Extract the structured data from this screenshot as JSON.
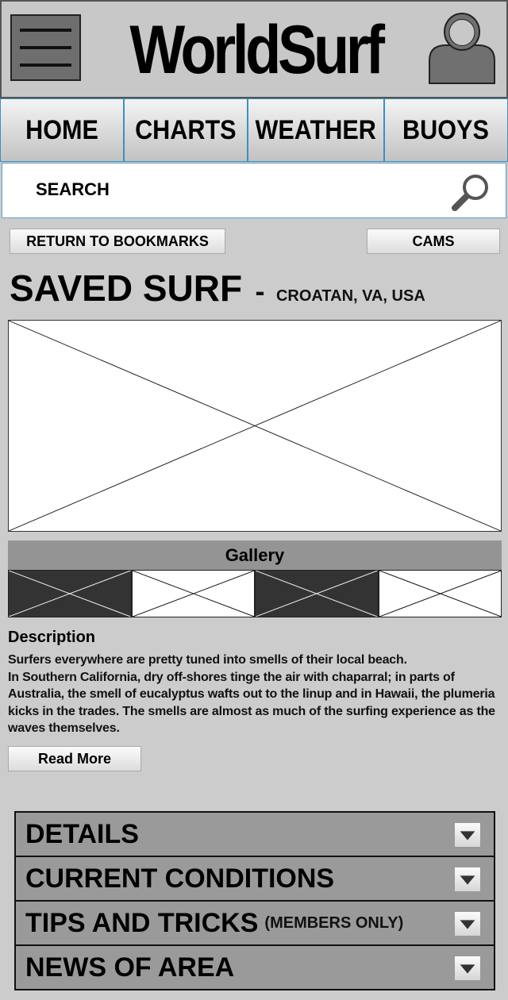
{
  "header": {
    "logo": "WorldSurf",
    "menu_icon": "hamburger-menu-icon",
    "profile_icon": "user-profile-icon"
  },
  "nav": {
    "tabs": [
      {
        "label": "HOME"
      },
      {
        "label": "CHARTS"
      },
      {
        "label": "WEATHER"
      },
      {
        "label": "BUOYS"
      }
    ]
  },
  "search": {
    "label": "SEARCH",
    "icon": "magnifier-icon"
  },
  "actions": {
    "return_label": "RETURN TO BOOKMARKS",
    "cams_label": "CAMS"
  },
  "page": {
    "title": "SAVED SURF",
    "separator": "-",
    "location": "CROATAN, VA, USA"
  },
  "gallery": {
    "title": "Gallery",
    "thumbnails": [
      "dark",
      "light",
      "dark",
      "light"
    ]
  },
  "description": {
    "title": "Description",
    "text": "Surfers everywhere are pretty tuned into smells of their local beach.\nIn Southern California, dry off-shores tinge the air with chaparral; in parts of Australia, the smell of eucalyptus wafts out to the linup and in Hawaii, the plumeria kicks in the trades. The smells are almost as much of the surfing experience as the waves themselves.",
    "read_more": "Read More"
  },
  "accordion": [
    {
      "label": "DETAILS",
      "sub": ""
    },
    {
      "label": "CURRENT CONDITIONS",
      "sub": ""
    },
    {
      "label": "TIPS AND TRICKS",
      "sub": "(MEMBERS ONLY)"
    },
    {
      "label": "NEWS OF AREA",
      "sub": ""
    }
  ],
  "colors": {
    "background": "#cccccc",
    "tab_border": "#3e8ec0",
    "gallery_bar": "#949494",
    "accordion_row": "#9a9a9a"
  }
}
